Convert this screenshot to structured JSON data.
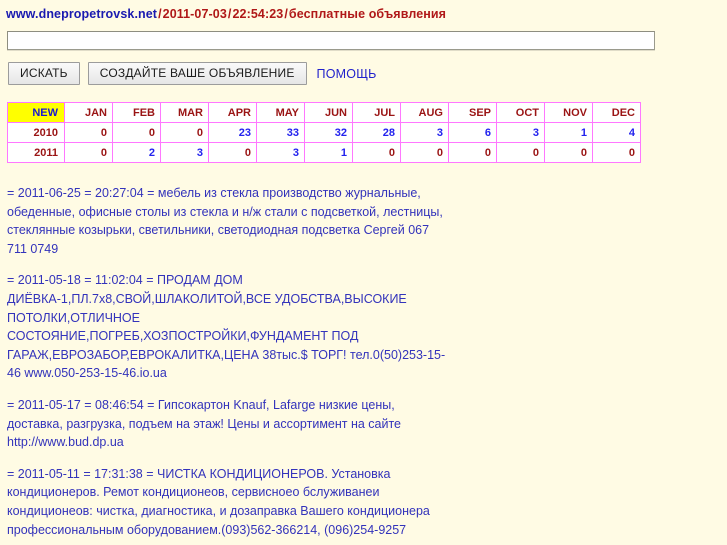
{
  "header": {
    "domain": "www.dnepropetrovsk.net",
    "separator": "/",
    "date": "2011-07-03",
    "time": "22:54:23",
    "tagline": "бесплатные объявления"
  },
  "search": {
    "value": "",
    "placeholder": ""
  },
  "toolbar": {
    "search_button": "ИСКАТЬ",
    "create_ad_button": "СОЗДАЙТЕ ВАШЕ ОБЪЯВЛЕНИЕ",
    "help_link": "ПОМОЩЬ"
  },
  "stats_table": {
    "new_label": "NEW",
    "months": [
      "JAN",
      "FEB",
      "MAR",
      "APR",
      "MAY",
      "JUN",
      "JUL",
      "AUG",
      "SEP",
      "OCT",
      "NOV",
      "DEC"
    ],
    "rows": [
      {
        "year": "2010",
        "values": [
          "0",
          "0",
          "0",
          "23",
          "33",
          "32",
          "28",
          "3",
          "6",
          "3",
          "1",
          "4"
        ]
      },
      {
        "year": "2011",
        "values": [
          "0",
          "2",
          "3",
          "0",
          "3",
          "1",
          "0",
          "0",
          "0",
          "0",
          "0",
          "0"
        ]
      }
    ]
  },
  "listings": [
    {
      "text": "= 2011-06-25 = 20:27:04 = мебель из стекла производство журнальные, обеденные, офисные столы из стекла и н/ж стали с подсветкой, лестницы, стеклянные козырьки, светильники, светодиодная подсветка Сергей 067 711 0749"
    },
    {
      "text": "= 2011-05-18 = 11:02:04 = ПРОДАМ ДОМ ДИЁВКА-1,ПЛ.7х8,СВОЙ,ШЛАКОЛИТОЙ,ВСЕ УДОБСТВА,ВЫСОКИЕ ПОТОЛКИ,ОТЛИЧНОЕ СОСТОЯНИЕ,ПОГРЕБ,ХОЗПОСТРОЙКИ,ФУНДАМЕНТ ПОД ГАРАЖ,ЕВРОЗАБОР,ЕВРОКАЛИТКА,ЦЕНА 38тыс.$ ТОРГ! тел.0(50)253-15-46 www.050-253-15-46.io.ua"
    },
    {
      "text": "= 2011-05-17 = 08:46:54 = Гипсокартон Knauf, Lafarge низкие цены, доставка, разгрузка, подъем на этаж! Цены и ассортимент на сайте http://www.bud.dp.ua"
    },
    {
      "text": "= 2011-05-11 = 17:31:38 = ЧИСТКА КОНДИЦИОНЕРОВ. Установка кондиционеров. Ремот кондиционеов, сервисноео бслуживанеи кондиционеов: чистка, диагностика, и дозаправка Вашего кондиционера профессиональным оборудованием.(093)562-366214, (096)254-9257"
    }
  ],
  "colors": {
    "page_background": "#FFFBE4",
    "domain_text": "#1A1AB0",
    "header_red": "#B01818",
    "table_border": "#FF77FF",
    "new_cell_background": "#FFFF00",
    "zero_value": "#9A1414",
    "nonzero_value": "#2222EE",
    "listing_text": "#3333BB",
    "link": "#2222CC"
  }
}
